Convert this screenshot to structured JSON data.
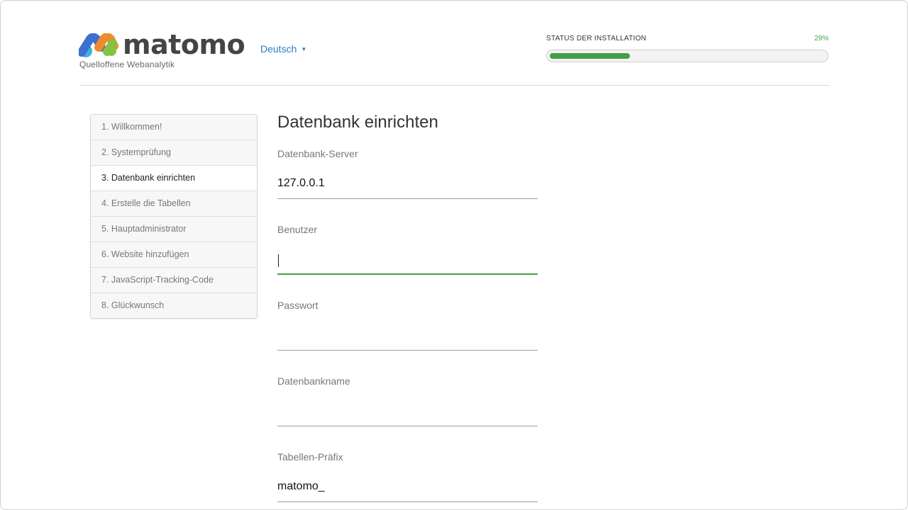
{
  "header": {
    "logo_text": "matomo",
    "tagline": "Quelloffene Webanalytik",
    "language": "Deutsch",
    "status_label": "STATUS DER INSTALLATION",
    "progress_percent_text": "29%",
    "progress_fraction": 0.29,
    "colors": {
      "accent_green": "#43a047",
      "link_blue": "#2b7cc3"
    }
  },
  "steps": [
    {
      "label": "1. Willkommen!",
      "active": false
    },
    {
      "label": "2. Systemprüfung",
      "active": false
    },
    {
      "label": "3. Datenbank einrichten",
      "active": true
    },
    {
      "label": "4. Erstelle die Tabellen",
      "active": false
    },
    {
      "label": "5. Hauptadministrator",
      "active": false
    },
    {
      "label": "6. Website hinzufügen",
      "active": false
    },
    {
      "label": "7. JavaScript-Tracking-Code",
      "active": false
    },
    {
      "label": "8. Glückwunsch",
      "active": false
    }
  ],
  "main": {
    "title": "Datenbank einrichten",
    "fields": {
      "server": {
        "label": "Datenbank-Server",
        "value": "127.0.0.1"
      },
      "user": {
        "label": "Benutzer",
        "value": ""
      },
      "password": {
        "label": "Passwort",
        "value": ""
      },
      "dbname": {
        "label": "Datenbankname",
        "value": ""
      },
      "prefix": {
        "label": "Tabellen-Präfix",
        "value": "matomo_"
      }
    }
  }
}
